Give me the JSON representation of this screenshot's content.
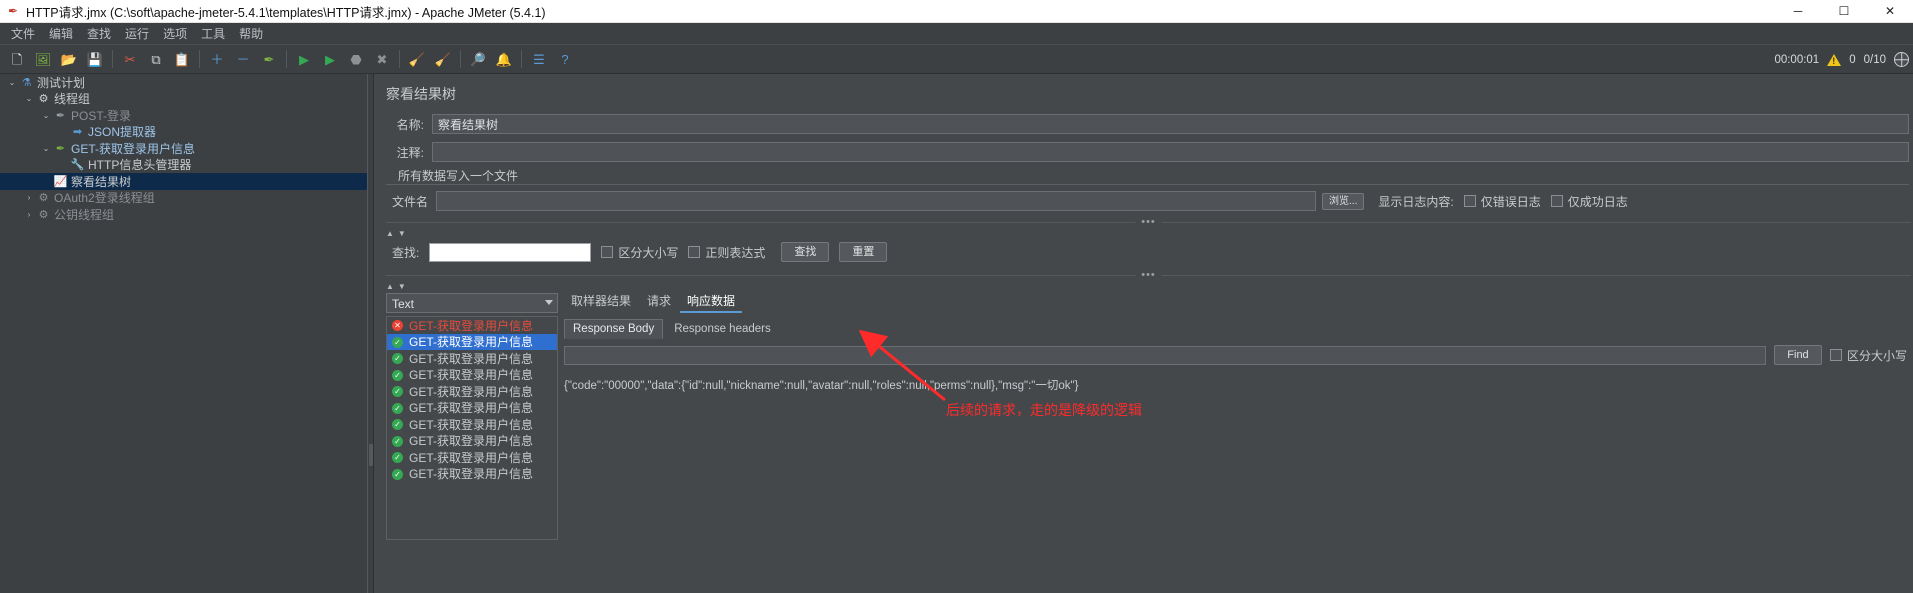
{
  "window": {
    "title": "HTTP请求.jmx (C:\\soft\\apache-jmeter-5.4.1\\templates\\HTTP请求.jmx) - Apache JMeter (5.4.1)",
    "app_icon": "jmeter-feather-icon",
    "minimize": "─",
    "maximize": "☐",
    "close": "✕"
  },
  "menubar": {
    "items": [
      {
        "label": "文件",
        "name": "menu-file"
      },
      {
        "label": "编辑",
        "name": "menu-edit"
      },
      {
        "label": "查找",
        "name": "menu-search"
      },
      {
        "label": "运行",
        "name": "menu-run"
      },
      {
        "label": "选项",
        "name": "menu-options"
      },
      {
        "label": "工具",
        "name": "menu-tools"
      },
      {
        "label": "帮助",
        "name": "menu-help"
      }
    ]
  },
  "toolbar": {
    "buttons": [
      {
        "name": "new-icon",
        "glyph": "🗋",
        "color": "#f0f0f0"
      },
      {
        "name": "templates-icon",
        "glyph": "🖼",
        "color": "#7cb342"
      },
      {
        "name": "open-icon",
        "glyph": "📂",
        "color": "#e8a33d"
      },
      {
        "name": "save-icon",
        "glyph": "💾",
        "color": "#c8cbce"
      },
      {
        "name": "separator-1",
        "glyph": "|",
        "color": ""
      },
      {
        "name": "cut-icon",
        "glyph": "✂",
        "color": "#e05c4a"
      },
      {
        "name": "copy-icon",
        "glyph": "⧉",
        "color": "#cfd2d5"
      },
      {
        "name": "paste-icon",
        "glyph": "📋",
        "color": "#e8a33d"
      },
      {
        "name": "separator-2",
        "glyph": "|",
        "color": ""
      },
      {
        "name": "expand-all-icon",
        "glyph": "＋",
        "color": "#5a9bd5"
      },
      {
        "name": "collapse-all-icon",
        "glyph": "－",
        "color": "#5a9bd5"
      },
      {
        "name": "toggle-icon",
        "glyph": "✒",
        "color": "#7cb342"
      },
      {
        "name": "separator-3",
        "glyph": "|",
        "color": ""
      },
      {
        "name": "start-icon",
        "glyph": "▶",
        "color": "#34a853"
      },
      {
        "name": "start-no-pauses-icon",
        "glyph": "▶",
        "color": "#34a853"
      },
      {
        "name": "stop-icon",
        "glyph": "⬣",
        "color": "#8d9194"
      },
      {
        "name": "shutdown-icon",
        "glyph": "✖",
        "color": "#8d9194"
      },
      {
        "name": "separator-4",
        "glyph": "|",
        "color": ""
      },
      {
        "name": "clear-icon",
        "glyph": "🧹",
        "color": "#c8cbce"
      },
      {
        "name": "clear-all-icon",
        "glyph": "🧹",
        "color": "#c8cbce"
      },
      {
        "name": "separator-5",
        "glyph": "|",
        "color": ""
      },
      {
        "name": "search-icon",
        "glyph": "🔎",
        "color": "#2b2b2b"
      },
      {
        "name": "search-reset-icon",
        "glyph": "🔔",
        "color": "#e8c33d"
      },
      {
        "name": "separator-6",
        "glyph": "|",
        "color": ""
      },
      {
        "name": "function-helper-icon",
        "glyph": "☰",
        "color": "#5a9bd5"
      },
      {
        "name": "help-icon",
        "glyph": "?",
        "color": "#5a9bd5"
      }
    ],
    "status": {
      "elapsed": "00:00:01",
      "warning_icon": "warning-triangle-icon",
      "errors": "0",
      "threads": "0/10",
      "remote_icon": "globe-icon"
    }
  },
  "tree": {
    "items": [
      {
        "label": "测试计划",
        "indent": 0,
        "twist": "⌄",
        "icon": "⚗",
        "icon_color": "#5a9bd5",
        "style": "normal",
        "selected": false,
        "name": "tree-item-test-plan"
      },
      {
        "label": "线程组",
        "indent": 1,
        "twist": "⌄",
        "icon": "⚙",
        "icon_color": "#cfd2d5",
        "style": "normal",
        "selected": false,
        "name": "tree-item-thread-group"
      },
      {
        "label": "POST-登录",
        "indent": 2,
        "twist": "⌄",
        "icon": "✒",
        "icon_color": "#9aa0a6",
        "style": "disabled",
        "selected": false,
        "name": "tree-item-post-login"
      },
      {
        "label": "JSON提取器",
        "indent": 3,
        "twist": "",
        "icon": "➡",
        "icon_color": "#5a9bd5",
        "style": "blue",
        "selected": false,
        "name": "tree-item-json-extractor"
      },
      {
        "label": "GET-获取登录用户信息",
        "indent": 2,
        "twist": "⌄",
        "icon": "✒",
        "icon_color": "#7cb342",
        "style": "blue",
        "selected": false,
        "name": "tree-item-get-userinfo"
      },
      {
        "label": "HTTP信息头管理器",
        "indent": 3,
        "twist": "",
        "icon": "🔧",
        "icon_color": "#e8a33d",
        "style": "normal",
        "selected": false,
        "name": "tree-item-http-header-manager"
      },
      {
        "label": "察看结果树",
        "indent": 2,
        "twist": "",
        "icon": "📈",
        "icon_color": "#e8a0d8",
        "style": "normal",
        "selected": true,
        "name": "tree-item-view-results-tree"
      },
      {
        "label": "OAuth2登录线程组",
        "indent": 1,
        "twist": "›",
        "icon": "⚙",
        "icon_color": "#8b8f93",
        "style": "disabled",
        "selected": false,
        "name": "tree-item-oauth2-thread-group"
      },
      {
        "label": "公钥线程组",
        "indent": 1,
        "twist": "›",
        "icon": "⚙",
        "icon_color": "#8b8f93",
        "style": "disabled",
        "selected": false,
        "name": "tree-item-pubkey-thread-group"
      }
    ]
  },
  "panel": {
    "title": "察看结果树",
    "name_label": "名称:",
    "name_value": "察看结果树",
    "comment_label": "注释:",
    "comment_value": "",
    "fieldset_legend": "所有数据写入一个文件",
    "filename_label": "文件名",
    "filename_value": "",
    "browse_button": "浏览...",
    "log_display_label": "显示日志内容:",
    "log_errors_only": "仅错误日志",
    "log_success_only": "仅成功日志",
    "dots": "•••"
  },
  "search": {
    "label": "查找:",
    "value": "",
    "case_sensitive": "区分大小写",
    "regex": "正则表达式",
    "find_button": "查找",
    "reset_button": "重置"
  },
  "results": {
    "render_select": "Text",
    "tabs": [
      {
        "label": "取样器结果",
        "active": false,
        "name": "tab-sampler-result"
      },
      {
        "label": "请求",
        "active": false,
        "name": "tab-request"
      },
      {
        "label": "响应数据",
        "active": true,
        "name": "tab-response-data"
      }
    ],
    "subtabs": [
      {
        "label": "Response Body",
        "active": true,
        "name": "subtab-response-body"
      },
      {
        "label": "Response headers",
        "active": false,
        "name": "subtab-response-headers"
      }
    ],
    "find_button": "Find",
    "find_case_sensitive": "区分大小写",
    "response_body": "{\"code\":\"00000\",\"data\":{\"id\":null,\"nickname\":null,\"avatar\":null,\"roles\":null,\"perms\":null},\"msg\":\"一切ok\"}",
    "items": [
      {
        "label": "GET-获取登录用户信息",
        "state": "err",
        "selected": false,
        "highlight": true,
        "name": "result-list-item"
      },
      {
        "label": "GET-获取登录用户信息",
        "state": "ok",
        "selected": true,
        "highlight": false,
        "name": "result-list-item"
      },
      {
        "label": "GET-获取登录用户信息",
        "state": "ok",
        "selected": false,
        "highlight": false,
        "name": "result-list-item"
      },
      {
        "label": "GET-获取登录用户信息",
        "state": "ok",
        "selected": false,
        "highlight": false,
        "name": "result-list-item"
      },
      {
        "label": "GET-获取登录用户信息",
        "state": "ok",
        "selected": false,
        "highlight": false,
        "name": "result-list-item"
      },
      {
        "label": "GET-获取登录用户信息",
        "state": "ok",
        "selected": false,
        "highlight": false,
        "name": "result-list-item"
      },
      {
        "label": "GET-获取登录用户信息",
        "state": "ok",
        "selected": false,
        "highlight": false,
        "name": "result-list-item"
      },
      {
        "label": "GET-获取登录用户信息",
        "state": "ok",
        "selected": false,
        "highlight": false,
        "name": "result-list-item"
      },
      {
        "label": "GET-获取登录用户信息",
        "state": "ok",
        "selected": false,
        "highlight": false,
        "name": "result-list-item"
      },
      {
        "label": "GET-获取登录用户信息",
        "state": "ok",
        "selected": false,
        "highlight": false,
        "name": "result-list-item"
      }
    ]
  },
  "annotation": {
    "text": "后续的请求，走的是降级的逻辑",
    "color": "#ff2a2a",
    "arrow_name": "red-arrow-annotation"
  }
}
